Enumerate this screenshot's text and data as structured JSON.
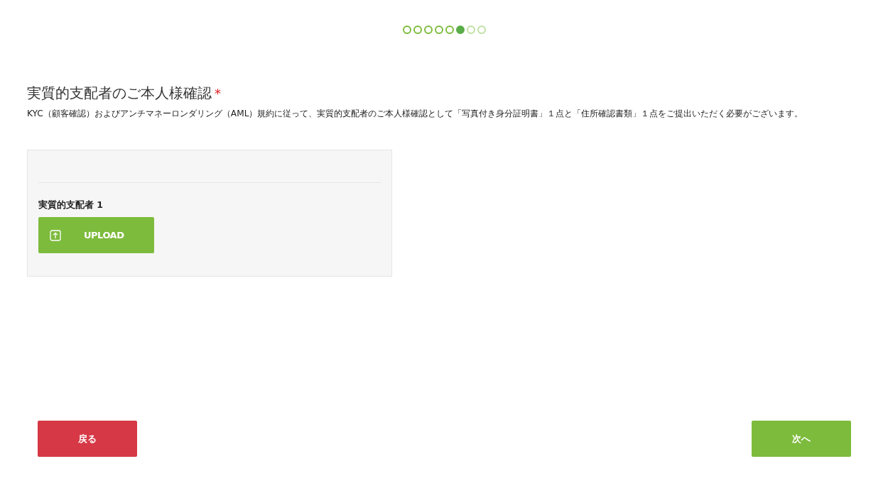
{
  "steps": [
    {
      "completed": true,
      "selected": false
    },
    {
      "completed": true,
      "selected": false
    },
    {
      "completed": true,
      "selected": false
    },
    {
      "completed": true,
      "selected": false
    },
    {
      "completed": true,
      "selected": false
    },
    {
      "completed": false,
      "selected": true
    },
    {
      "completed": false,
      "selected": false
    },
    {
      "completed": false,
      "selected": false
    }
  ],
  "section": {
    "title": "実質的支配者のご本人様確認",
    "required_mark": "*",
    "description": "KYC（顧客確認）およびアンチマネーロンダリング（AML）規約に従って、実質的支配者のご本人様確認として「写真付き身分証明書」１点と「住所確認書類」１点をご提出いただく必要がございます。"
  },
  "owners": [
    {
      "label": "実質的支配者 1",
      "button": "UPLOAD"
    }
  ],
  "buttons": {
    "back": "戻る",
    "next": "次へ"
  }
}
